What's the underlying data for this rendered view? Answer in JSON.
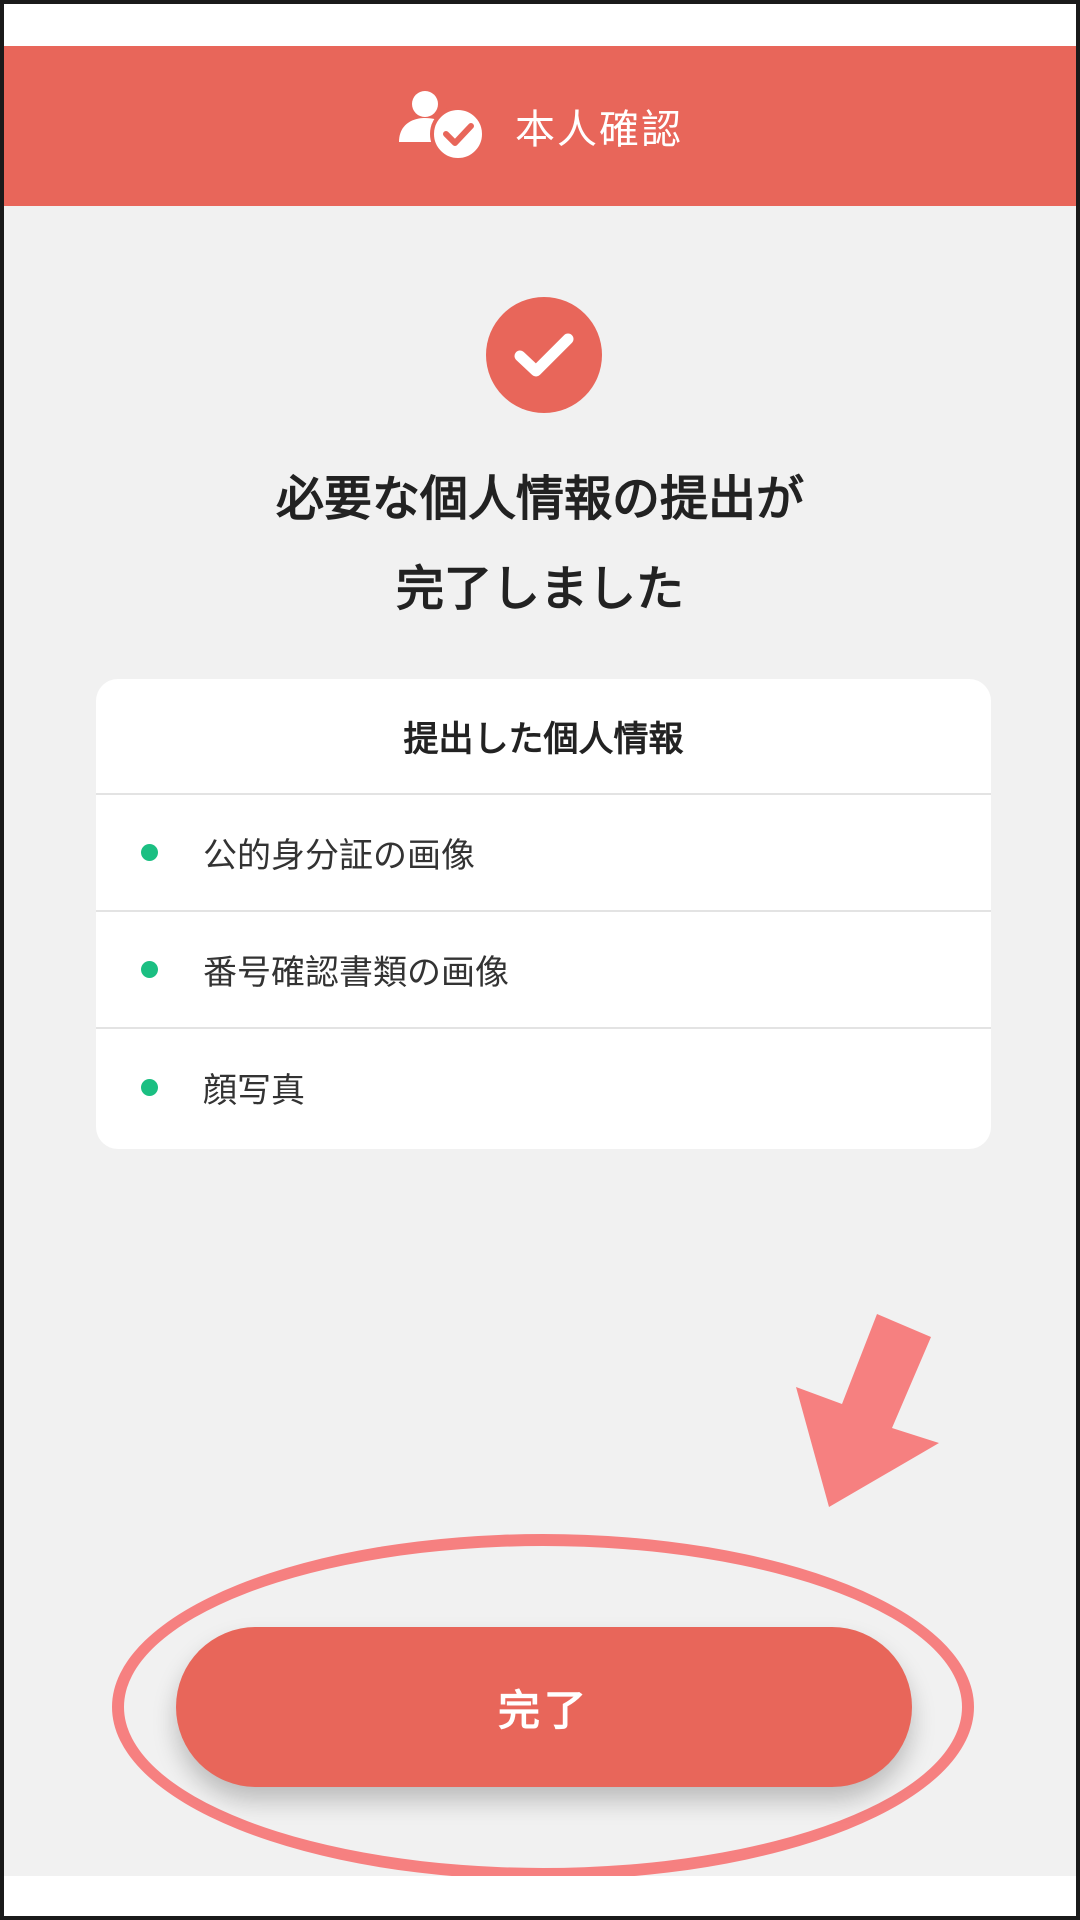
{
  "header": {
    "title": "本人確認",
    "icon": "user-check-icon"
  },
  "status": {
    "icon": "check-circle-icon",
    "message_line1": "必要な個人情報の提出が",
    "message_line2": "完了しました"
  },
  "submitted_card": {
    "title": "提出した個人情報",
    "items": [
      {
        "label": "公的身分証の画像"
      },
      {
        "label": "番号確認書類の画像"
      },
      {
        "label": "顔写真"
      }
    ]
  },
  "actions": {
    "done_label": "完了"
  },
  "colors": {
    "accent": "#e8665a",
    "bullet": "#1bbf82",
    "annotation": "#f68080",
    "background": "#f1f1f1"
  }
}
